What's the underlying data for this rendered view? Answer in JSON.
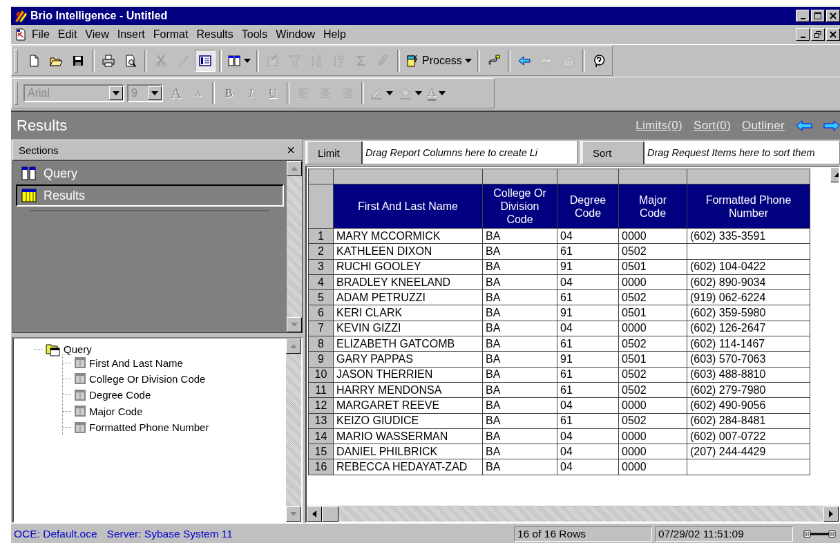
{
  "window": {
    "title": "Brio Intelligence - Untitled"
  },
  "menu": [
    "File",
    "Edit",
    "View",
    "Insert",
    "Format",
    "Results",
    "Tools",
    "Window",
    "Help"
  ],
  "toolbar_main": [
    [
      {
        "kind": "icon",
        "disabled": false,
        "pressed": false
      },
      {
        "kind": "icon",
        "disabled": false,
        "pressed": false
      },
      {
        "kind": "icon",
        "disabled": false,
        "pressed": false
      }
    ],
    [
      {
        "kind": "icon",
        "disabled": false,
        "pressed": false
      },
      {
        "kind": "icon",
        "disabled": false,
        "pressed": false
      }
    ],
    [
      {
        "kind": "icon",
        "disabled": true,
        "pressed": false
      },
      {
        "kind": "icon",
        "disabled": true,
        "pressed": false
      },
      {
        "kind": "icon",
        "disabled": false,
        "pressed": true
      }
    ],
    [
      {
        "kind": "icon",
        "disabled": false,
        "pressed": false,
        "dropdown": true
      }
    ],
    [
      {
        "kind": "icon",
        "disabled": true,
        "pressed": false
      },
      {
        "kind": "icon",
        "disabled": true,
        "pressed": false
      },
      {
        "kind": "icon",
        "disabled": true,
        "pressed": false
      },
      {
        "kind": "icon",
        "disabled": true,
        "pressed": false
      },
      {
        "kind": "icon",
        "disabled": true,
        "pressed": false
      },
      {
        "kind": "icon",
        "disabled": true,
        "pressed": false
      }
    ],
    [
      {
        "kind": "icon",
        "label": "Process",
        "disabled": false,
        "pressed": false,
        "dropdown": true
      }
    ],
    [
      {
        "kind": "icon",
        "disabled": false,
        "pressed": false
      }
    ],
    [
      {
        "kind": "icon",
        "disabled": false,
        "pressed": false
      },
      {
        "kind": "icon",
        "disabled": true,
        "pressed": false
      },
      {
        "kind": "icon",
        "disabled": true,
        "pressed": false
      }
    ],
    [
      {
        "kind": "icon",
        "disabled": false,
        "pressed": false
      }
    ]
  ],
  "toolbar_format": [
    [
      {
        "kind": "combo",
        "value": "Arial",
        "disabled": true
      },
      {
        "kind": "combo",
        "value": "9",
        "disabled": true
      },
      {
        "kind": "letter",
        "label": "A",
        "disabled": true
      },
      {
        "kind": "small-letter",
        "label": "A",
        "disabled": true
      }
    ],
    [
      {
        "kind": "bold",
        "label": "B",
        "disabled": true
      },
      {
        "kind": "italic",
        "label": "I",
        "disabled": true
      },
      {
        "kind": "underline",
        "label": "U",
        "disabled": true
      }
    ],
    [
      {
        "kind": "icon",
        "disabled": true
      },
      {
        "kind": "icon",
        "disabled": true
      },
      {
        "kind": "icon",
        "disabled": true
      }
    ],
    [
      {
        "kind": "icon",
        "disabled": true,
        "dropdown": true
      },
      {
        "kind": "icon",
        "disabled": true,
        "dropdown": true
      },
      {
        "kind": "underline-letter",
        "label": "A",
        "disabled": true,
        "dropdown": true
      }
    ]
  ],
  "section_header": {
    "title": "Results",
    "links": [
      "Limits(0)",
      "Sort(0)",
      "Outliner"
    ]
  },
  "sections": {
    "title": "Sections",
    "close": "×",
    "items": [
      {
        "label": "Query",
        "selected": false
      },
      {
        "label": "Results",
        "selected": true
      }
    ]
  },
  "outline": [
    {
      "label": "Query",
      "children": [
        {
          "label": "First And Last Name"
        },
        {
          "label": "College Or Division Code"
        },
        {
          "label": "Degree Code"
        },
        {
          "label": "Major Code"
        },
        {
          "label": "Formatted Phone Number"
        }
      ]
    }
  ],
  "limit_bar": {
    "label": "Limit",
    "placeholder": "Drag Report Columns here to create Li"
  },
  "sort_bar": {
    "label": "Sort",
    "placeholder": "Drag Request Items here to sort them"
  },
  "table": {
    "columns": [
      "First And Last Name",
      "College Or\nDivision\nCode",
      "Degree\nCode",
      "Major\nCode",
      "Formatted Phone\nNumber"
    ],
    "rows": [
      {
        "num": "1",
        "cells": [
          "MARY MCCORMICK",
          "BA",
          "04",
          "0000",
          "(602) 335-3591"
        ]
      },
      {
        "num": "2",
        "cells": [
          "KATHLEEN DIXON",
          "BA",
          "61",
          "0502"
        ]
      },
      {
        "num": "3",
        "cells": [
          "RUCHI GOOLEY",
          "BA",
          "91",
          "0501",
          "(602) 104-0422"
        ]
      },
      {
        "num": "4",
        "cells": [
          "BRADLEY KNEELAND",
          "BA",
          "04",
          "0000",
          "(602) 890-9034"
        ]
      },
      {
        "num": "5",
        "cells": [
          "ADAM PETRUZZI",
          "BA",
          "61",
          "0502",
          "(919) 062-6224"
        ]
      },
      {
        "num": "6",
        "cells": [
          "KERI CLARK",
          "BA",
          "91",
          "0501",
          "(602) 359-5980"
        ]
      },
      {
        "num": "7",
        "cells": [
          "KEVIN GIZZI",
          "BA",
          "04",
          "0000",
          "(602) 126-2647"
        ]
      },
      {
        "num": "8",
        "cells": [
          "ELIZABETH GATCOMB",
          "BA",
          "61",
          "0502",
          "(602) 114-1467"
        ]
      },
      {
        "num": "9",
        "cells": [
          "GARY PAPPAS",
          "BA",
          "91",
          "0501",
          "(603) 570-7063"
        ]
      },
      {
        "num": "10",
        "cells": [
          "JASON THERRIEN",
          "BA",
          "61",
          "0502",
          "(603) 488-8810"
        ]
      },
      {
        "num": "11",
        "cells": [
          "HARRY MENDONSA",
          "BA",
          "61",
          "0502",
          "(602) 279-7980"
        ]
      },
      {
        "num": "12",
        "cells": [
          "MARGARET REEVE",
          "BA",
          "04",
          "0000",
          "(602) 490-9056"
        ]
      },
      {
        "num": "13",
        "cells": [
          "KEIZO GIUDICE",
          "BA",
          "61",
          "0502",
          "(602) 284-8481"
        ]
      },
      {
        "num": "14",
        "cells": [
          "MARIO WASSERMAN",
          "BA",
          "04",
          "0000",
          "(602) 007-0722"
        ]
      },
      {
        "num": "15",
        "cells": [
          "DANIEL PHILBRICK",
          "BA",
          "04",
          "0000",
          "(207) 244-4429"
        ]
      },
      {
        "num": "16",
        "cells": [
          "REBECCA HEDAYAT-ZAD",
          "BA",
          "04",
          "0000"
        ]
      }
    ]
  },
  "status_bar": {
    "oce": "OCE: Default.oce",
    "server": "Server: Sybase System 11",
    "rows": "16 of 16 Rows",
    "timestamp": "07/29/02 11:51:09"
  }
}
